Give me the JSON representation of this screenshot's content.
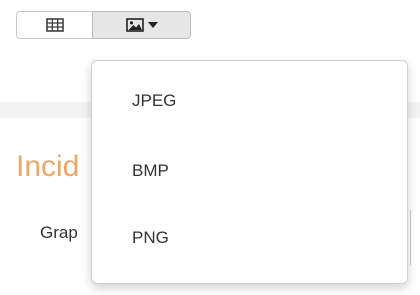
{
  "toolbar": {
    "table_view_icon": "table-grid-icon",
    "image_export_icon": "image-icon",
    "dropdown_icon": "caret-down-icon"
  },
  "export_menu": {
    "items": [
      {
        "label": "JPEG"
      },
      {
        "label": "BMP"
      },
      {
        "label": "PNG"
      }
    ]
  },
  "background": {
    "heading": "Incid",
    "sub_text": "Grap"
  },
  "colors": {
    "heading": "#f2a566",
    "text": "#333333",
    "active_button": "#e6e6e6",
    "band": "#f3f3f3"
  }
}
